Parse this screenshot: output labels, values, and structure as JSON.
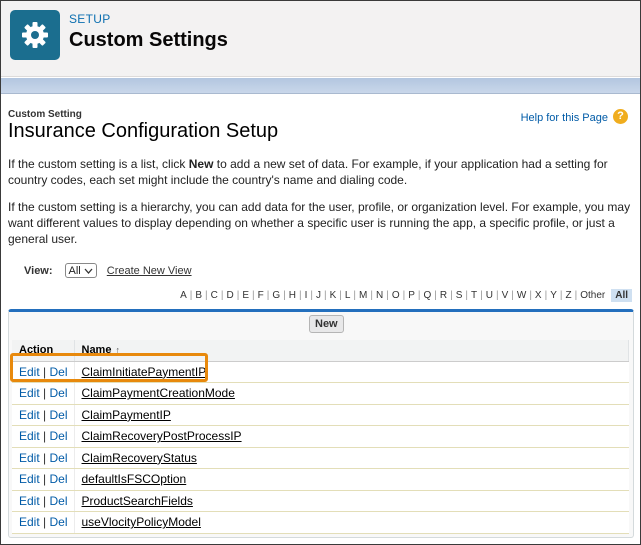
{
  "header": {
    "breadcrumb": "SETUP",
    "title": "Custom Settings",
    "icon": "gear-icon",
    "icon_bg": "#1b6e8f"
  },
  "page": {
    "type_label": "Custom Setting",
    "title": "Insurance Configuration Setup",
    "help_link": "Help for this Page"
  },
  "intro": {
    "p1_before": "If the custom setting is a list, click ",
    "p1_bold": "New",
    "p1_after": " to add a new set of data. For example, if your application had a setting for country codes, each set might include the country's name and dialing code.",
    "p2": "If the custom setting is a hierarchy, you can add data for the user, profile, or organization level. For example, you may want different values to display depending on whether a specific user is running the app, a specific profile, or just a general user."
  },
  "view": {
    "label": "View:",
    "selected": "All",
    "create_link": "Create New View"
  },
  "alphabet": [
    "A",
    "B",
    "C",
    "D",
    "E",
    "F",
    "G",
    "H",
    "I",
    "J",
    "K",
    "L",
    "M",
    "N",
    "O",
    "P",
    "Q",
    "R",
    "S",
    "T",
    "U",
    "V",
    "W",
    "X",
    "Y",
    "Z",
    "Other",
    "All"
  ],
  "list": {
    "new_button": "New",
    "columns": {
      "action": "Action",
      "name": "Name"
    },
    "edit_label": "Edit",
    "del_label": "Del",
    "rows": [
      "ClaimInitiatePaymentIP",
      "ClaimPaymentCreationMode",
      "ClaimPaymentIP",
      "ClaimRecoveryPostProcessIP",
      "ClaimRecoveryStatus",
      "defaultIsFSCOption",
      "ProductSearchFields",
      "useVlocityPolicyModel"
    ]
  },
  "colors": {
    "link": "#015ba7",
    "highlight": "#e8890c",
    "panel_accent": "#236fbd"
  }
}
